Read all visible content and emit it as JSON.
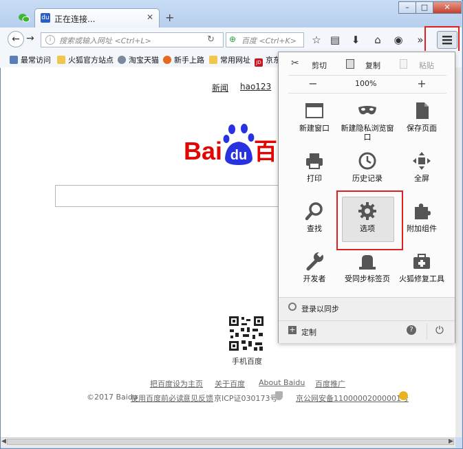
{
  "browser": {
    "tab_title": "正在连接...",
    "new_tab_label": "+",
    "url_placeholder": "搜索或输入网址 <Ctrl+L>",
    "search_placeholder": "百度 <Ctrl+K>",
    "window_controls": [
      "–",
      "□",
      "✕"
    ]
  },
  "bookmarks": [
    "最常访问",
    "火狐官方站点",
    "淘宝天猫",
    "新手上路",
    "常用网址",
    "京东"
  ],
  "page": {
    "top_links": [
      "新闻",
      "hao123"
    ],
    "logo_text": "Bai",
    "logo_du": "du",
    "logo_suffix": "百",
    "qr_label": "手机百度",
    "footer_links": [
      "把百度设为主页",
      "关于百度",
      "About Baidu",
      "百度推广"
    ],
    "copyright": "©2017 Baidu",
    "legal_links": [
      "使用百度前必读",
      "意见反馈"
    ],
    "icp": "京ICP证030173号",
    "police": "京公网安备11000002000001号"
  },
  "menu": {
    "edit": {
      "cut": "剪切",
      "copy": "复制",
      "paste": "粘贴"
    },
    "zoom": {
      "minus": "−",
      "level": "100%",
      "plus": "+"
    },
    "buttons": [
      {
        "label": "新建窗口",
        "icon": "window-icon"
      },
      {
        "label": "新建隐私浏览窗口",
        "icon": "mask-icon"
      },
      {
        "label": "保存页面",
        "icon": "page-icon"
      },
      {
        "label": "打印",
        "icon": "printer-icon"
      },
      {
        "label": "历史记录",
        "icon": "clock-icon"
      },
      {
        "label": "全屏",
        "icon": "fullscreen-icon"
      },
      {
        "label": "查找",
        "icon": "magnifier-icon"
      },
      {
        "label": "选项",
        "icon": "gear-icon"
      },
      {
        "label": "附加组件",
        "icon": "puzzle-icon"
      },
      {
        "label": "开发者",
        "icon": "wrench-icon"
      },
      {
        "label": "受同步标签页",
        "icon": "synced-tabs-icon"
      },
      {
        "label": "火狐修复工具",
        "icon": "toolbox-icon"
      }
    ],
    "sync_label": "登录以同步",
    "customize_label": "定制"
  },
  "colors": {
    "highlight": "#e02020",
    "baidu_red": "#e10601",
    "baidu_blue": "#2932e1"
  }
}
